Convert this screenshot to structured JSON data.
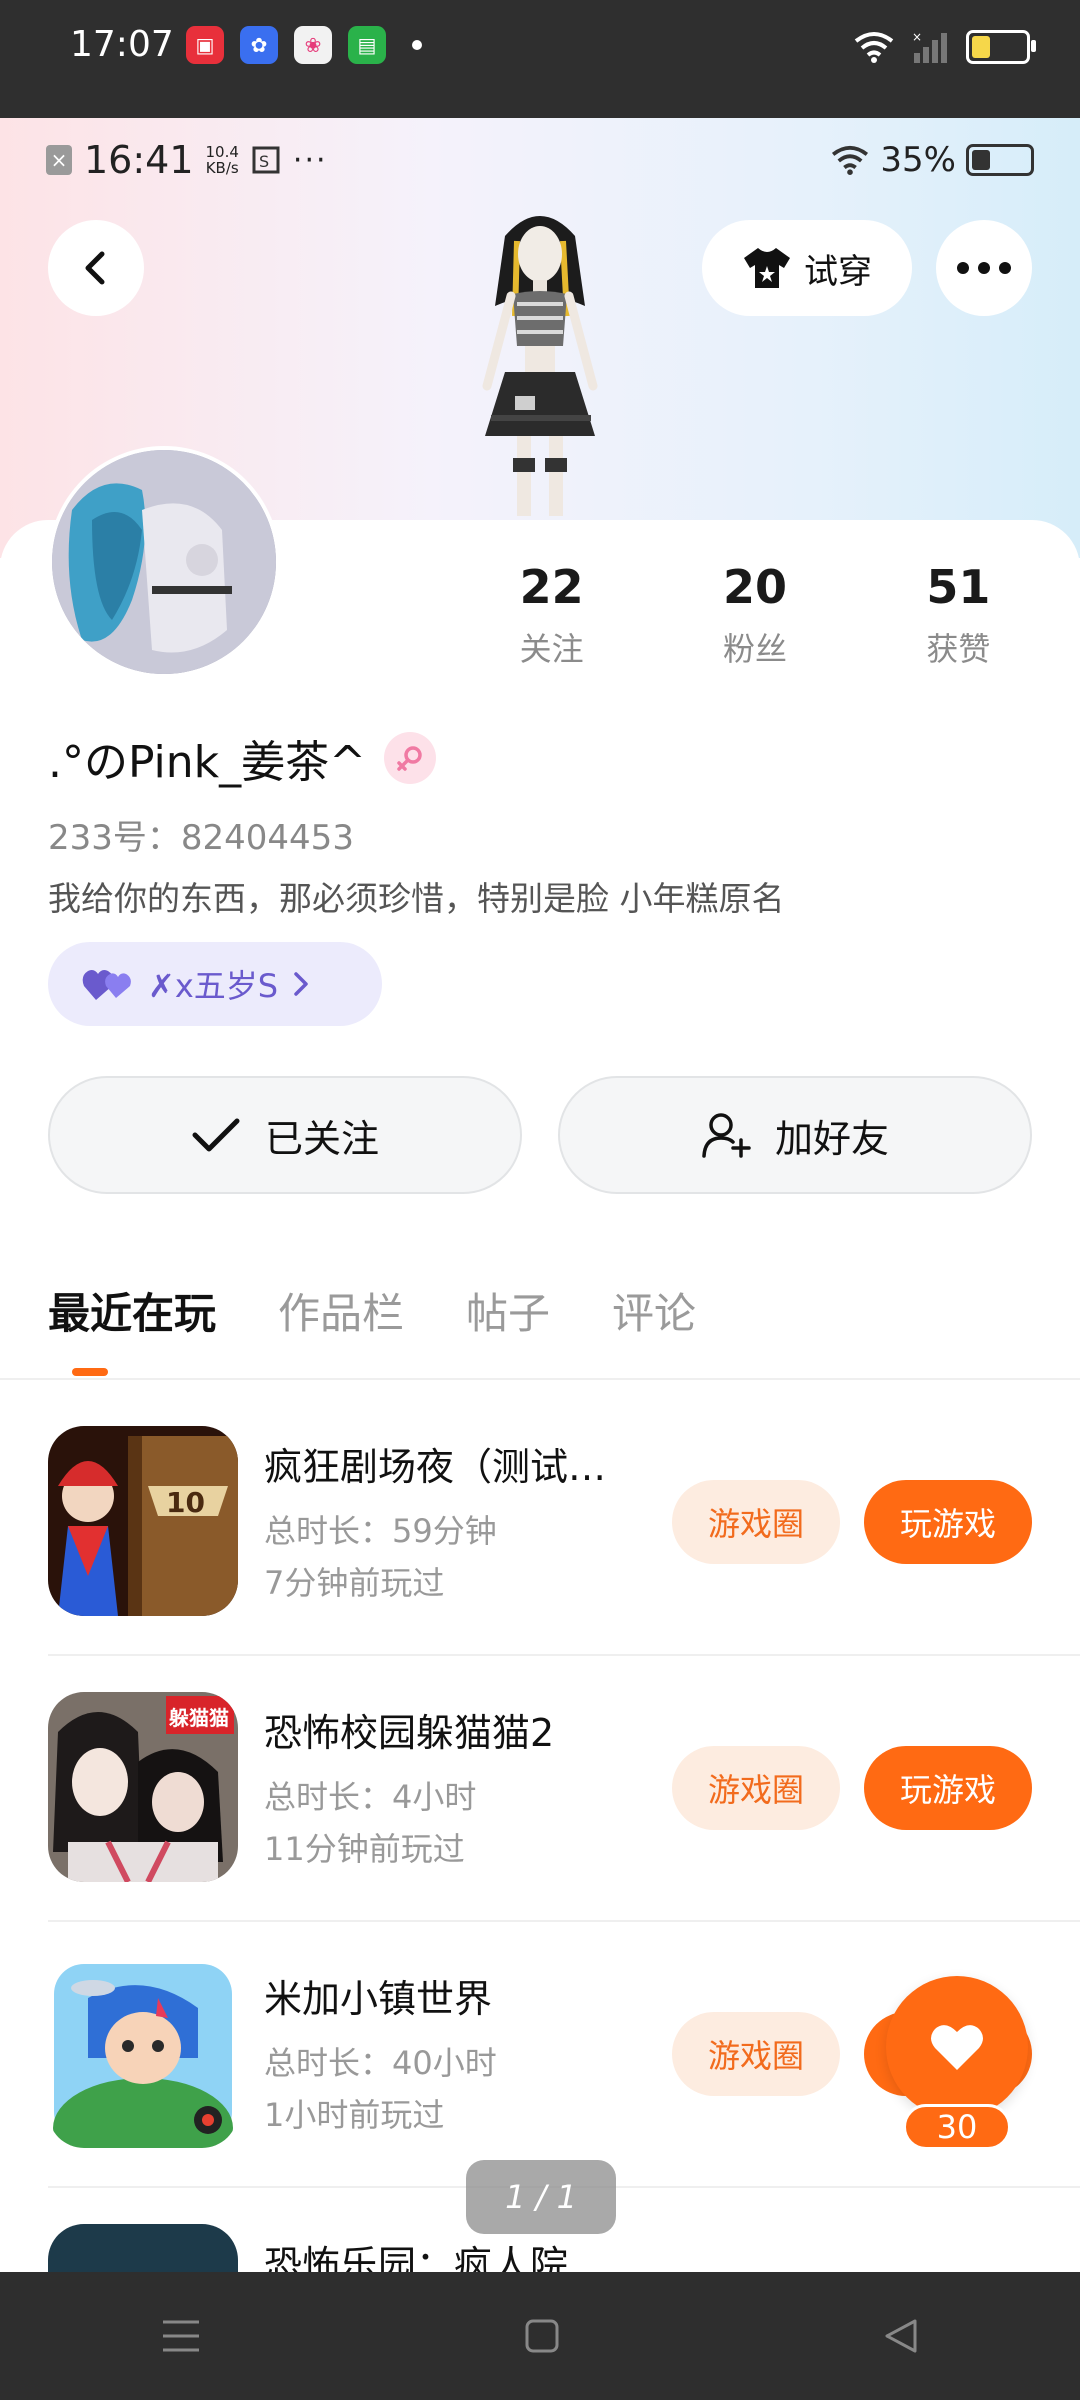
{
  "system_bar": {
    "time": "17:07",
    "app_icons": [
      "app-red-icon",
      "baidu-paw-icon",
      "app-colorful-icon",
      "app-green-icon"
    ],
    "battery_fraction": 0.35
  },
  "inner_status": {
    "time": "16:41",
    "speed_value": "10.4",
    "speed_unit": "KB/s",
    "battery": "35%"
  },
  "header": {
    "tryon_label": "试穿"
  },
  "stats": [
    {
      "value": "22",
      "label": "关注"
    },
    {
      "value": "20",
      "label": "粉丝"
    },
    {
      "value": "51",
      "label": "获赞"
    }
  ],
  "profile": {
    "username": ".°のPink_姜茶^",
    "uid": "233号：82404453",
    "bio": "我给你的东西，那必须珍惜，特别是脸   小年糕原名",
    "club": "✗x五岁S"
  },
  "actions": {
    "followed_label": "已关注",
    "add_friend_label": "加好友"
  },
  "tabs": [
    "最近在玩",
    "作品栏",
    "帖子",
    "评论"
  ],
  "games": [
    {
      "title": "疯狂剧场夜（测试…",
      "duration": "总时长：59分钟",
      "last_played": "7分钟前玩过",
      "circle_label": "游戏圈",
      "play_label": "玩游戏"
    },
    {
      "title": "恐怖校园躲猫猫2",
      "duration": "总时长：4小时",
      "last_played": "11分钟前玩过",
      "circle_label": "游戏圈",
      "play_label": "玩游戏"
    },
    {
      "title": "米加小镇世界",
      "duration": "总时长：40小时",
      "last_played": "1小时前玩过",
      "circle_label": "游戏圈",
      "play_label": "玩游戏"
    },
    {
      "title": "恐怖乐园：疯人院…"
    }
  ],
  "icon_text": {
    "game1_badge": "10",
    "game2_badge": "躲猫猫"
  },
  "like": {
    "count": "30"
  },
  "pager": {
    "text": "1 / 1"
  },
  "colors": {
    "accent": "#ff6a13",
    "accent_soft": "#fdece0",
    "club_bg": "#ecebfc"
  }
}
